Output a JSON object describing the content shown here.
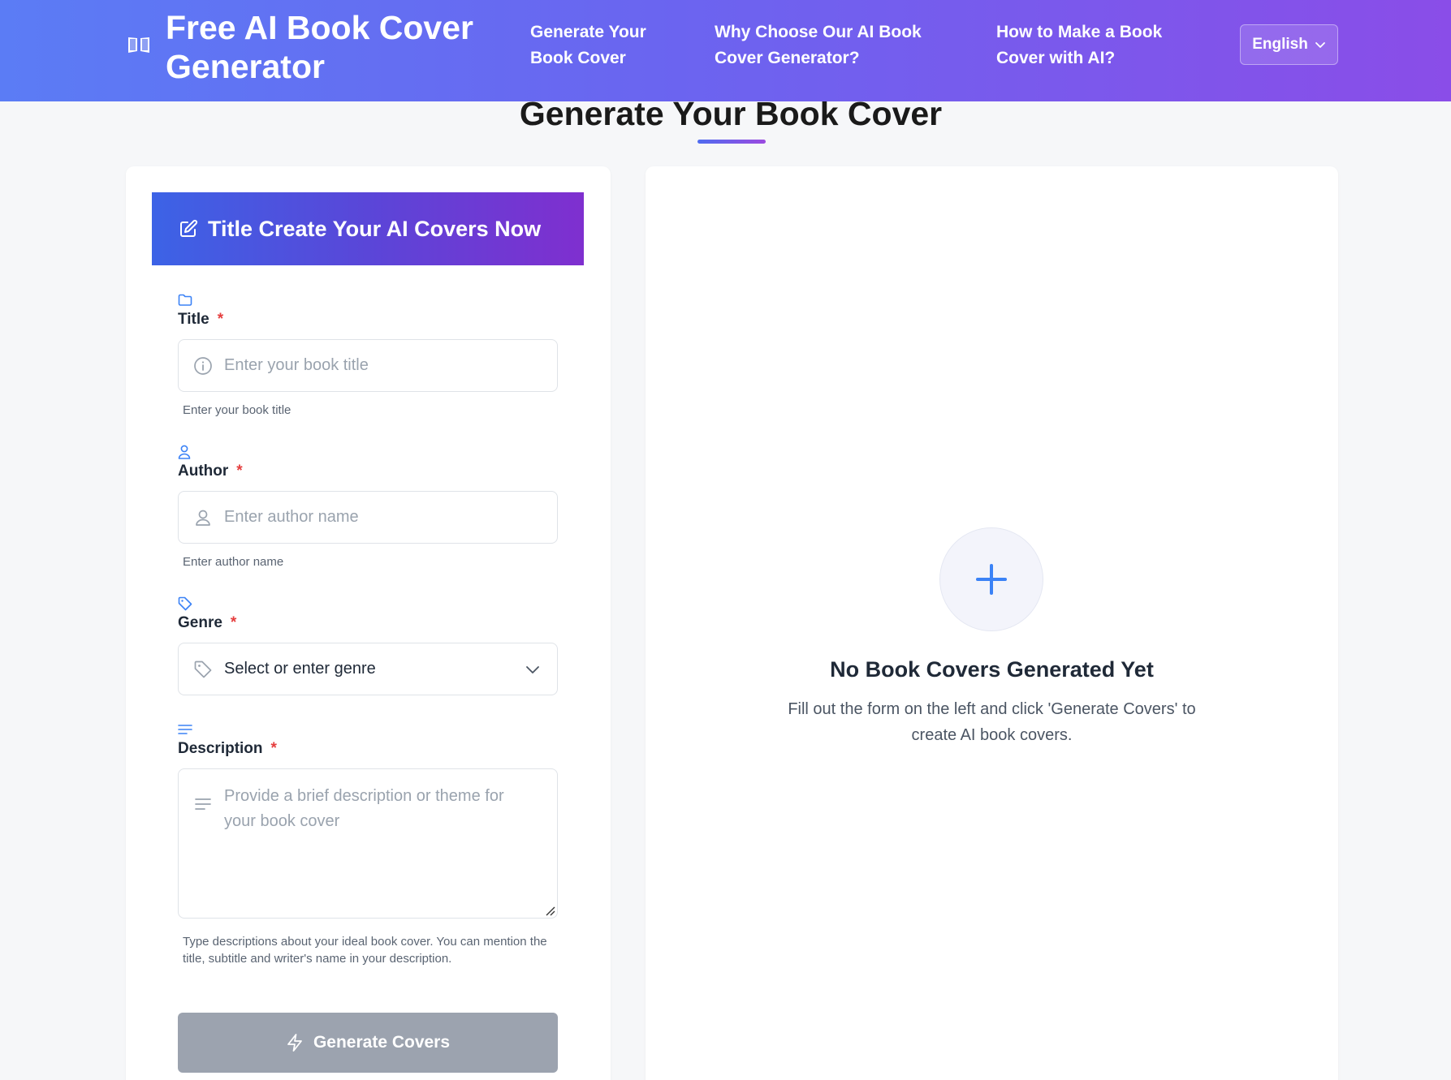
{
  "header": {
    "logo_text": "Free AI Book Cover Generator",
    "nav": [
      {
        "label": "Generate Your Book Cover"
      },
      {
        "label": "Why Choose Our AI Book Cover Generator?"
      },
      {
        "label": "How to Make a Book Cover with AI?"
      }
    ],
    "language": "English"
  },
  "section": {
    "title": "Generate Your Book Cover"
  },
  "form": {
    "banner": "Title Create Your AI Covers Now",
    "title_field": {
      "label": "Title",
      "required_mark": "*",
      "placeholder": "Enter your book title",
      "help": "Enter your book title"
    },
    "author_field": {
      "label": "Author",
      "required_mark": "*",
      "placeholder": "Enter author name",
      "help": "Enter author name"
    },
    "genre_field": {
      "label": "Genre",
      "required_mark": "*",
      "value": "Select or enter genre"
    },
    "description_field": {
      "label": "Description",
      "required_mark": "*",
      "placeholder": "Provide a brief description or theme for your book cover",
      "help": "Type descriptions about your ideal book cover. You can mention the title, subtitle and writer's name in your description."
    },
    "submit_label": "Generate Covers"
  },
  "preview": {
    "empty_title": "No Book Covers Generated Yet",
    "empty_description": "Fill out the form on the left and click 'Generate Covers' to create AI book covers."
  },
  "colors": {
    "accent_blue": "#3b82f6",
    "header_gradient_start": "#5b7cf5",
    "header_gradient_end": "#8a4de8",
    "required": "#e53e3e",
    "button_disabled": "#9ca3af"
  },
  "icons": {
    "logo": "book-open-icon",
    "banner": "edit-icon",
    "title": "folder-icon",
    "author": "user-icon",
    "genre": "tag-icon",
    "description": "align-left-icon",
    "submit": "lightning-icon",
    "preview": "plus-icon"
  }
}
